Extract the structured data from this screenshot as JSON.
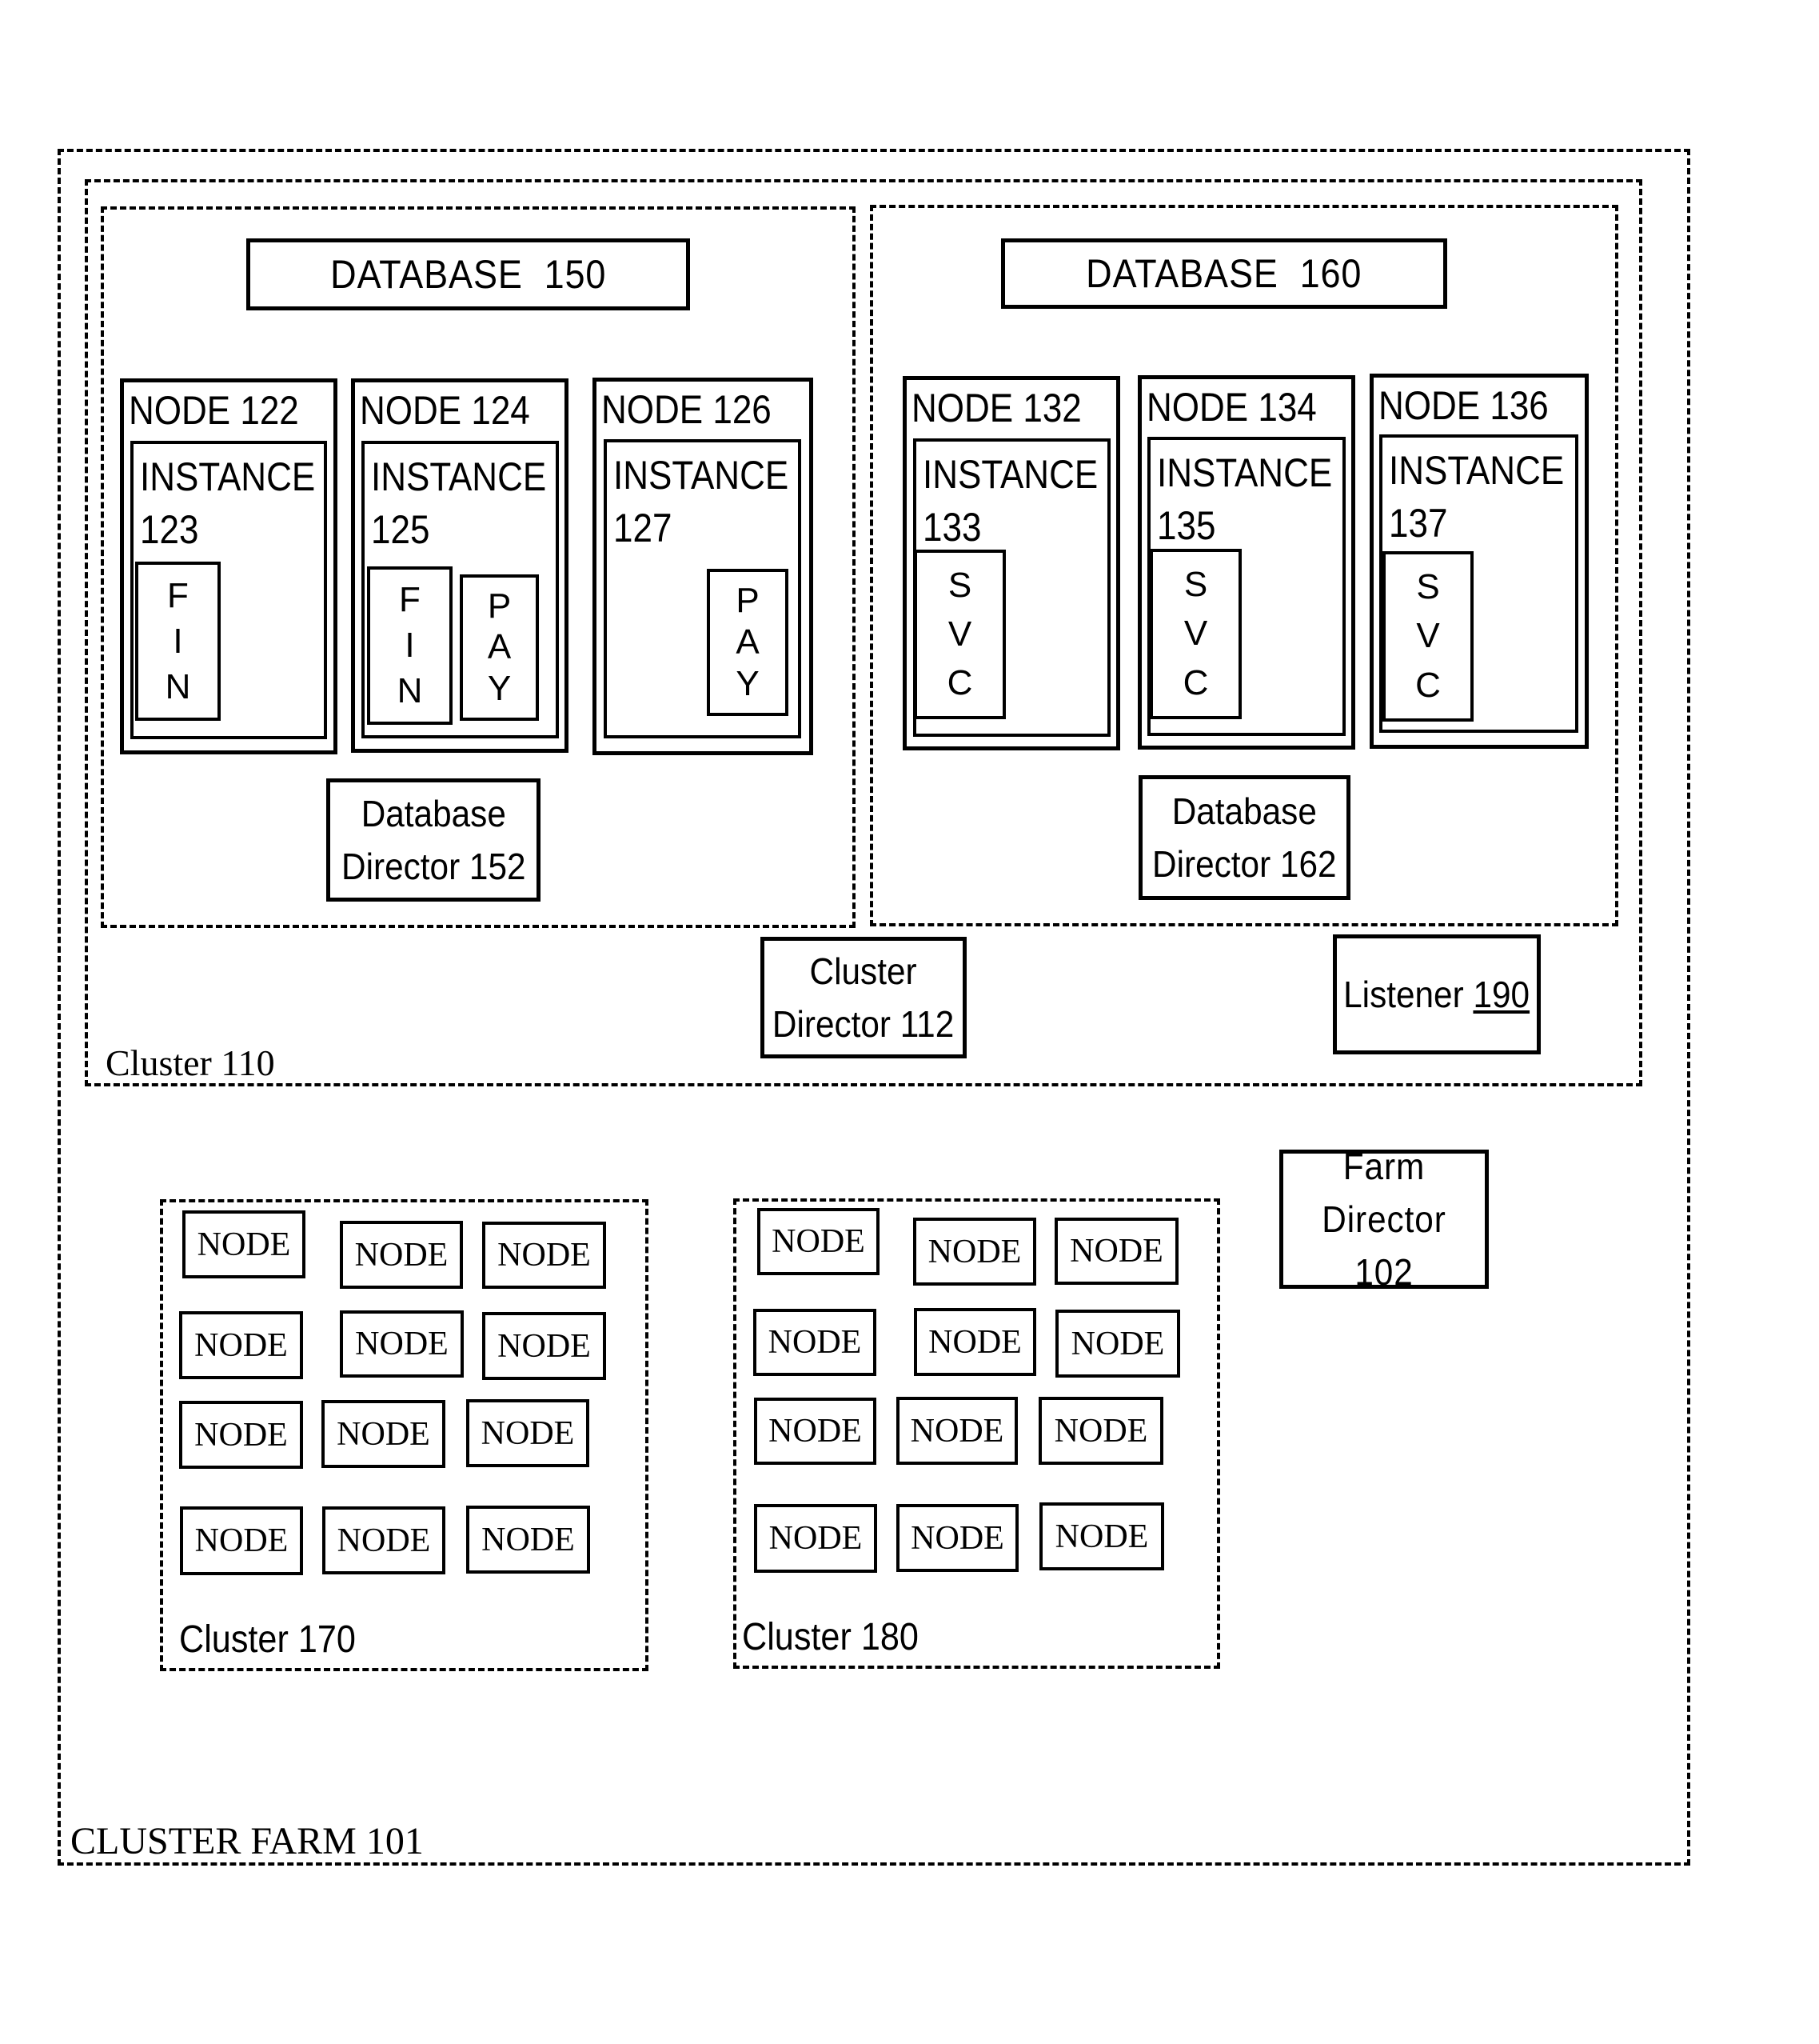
{
  "farm": {
    "label": "CLUSTER FARM 101",
    "farm_director": "Farm\nDirector 102"
  },
  "cluster110": {
    "label": "Cluster 110",
    "cluster_director": "Cluster\nDirector 112",
    "listener": {
      "text": "Listener ",
      "number": "190"
    },
    "database150": {
      "title": "DATABASE  150",
      "director": "Database\nDirector 152",
      "nodes": [
        {
          "title": "NODE 122",
          "instance": "INSTANCE\n123",
          "services": [
            [
              "F",
              "I",
              "N"
            ]
          ]
        },
        {
          "title": "NODE 124",
          "instance": "INSTANCE\n125",
          "services": [
            [
              "F",
              "I",
              "N"
            ],
            [
              "P",
              "A",
              "Y"
            ]
          ]
        },
        {
          "title": "NODE 126",
          "instance": "INSTANCE\n127",
          "services": [
            [
              "P",
              "A",
              "Y"
            ]
          ]
        }
      ]
    },
    "database160": {
      "title": "DATABASE  160",
      "director": "Database\nDirector 162",
      "nodes": [
        {
          "title": "NODE 132",
          "instance": "INSTANCE\n133",
          "services": [
            [
              "S",
              "V",
              "C"
            ]
          ]
        },
        {
          "title": "NODE 134",
          "instance": "INSTANCE\n135",
          "services": [
            [
              "S",
              "V",
              "C"
            ]
          ]
        },
        {
          "title": "NODE 136",
          "instance": "INSTANCE\n137",
          "services": [
            [
              "S",
              "V",
              "C"
            ]
          ]
        }
      ]
    }
  },
  "cluster170": {
    "label": "Cluster 170",
    "node_label": "NODE",
    "node_count": 12
  },
  "cluster180": {
    "label": "Cluster 180",
    "node_label": "NODE",
    "node_count": 12
  }
}
